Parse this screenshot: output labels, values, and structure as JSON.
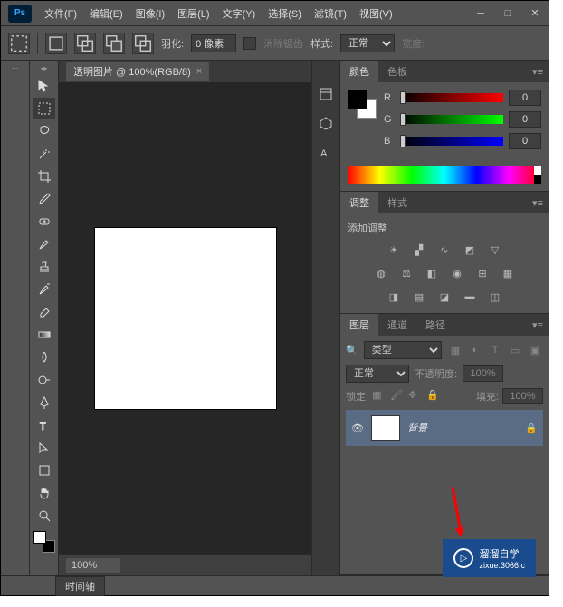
{
  "menu": [
    "文件(F)",
    "编辑(E)",
    "图像(I)",
    "图层(L)",
    "文字(Y)",
    "选择(S)",
    "滤镜(T)",
    "视图(V)"
  ],
  "options": {
    "feather_label": "羽化:",
    "feather_value": "0 像素",
    "antialias": "消除锯齿",
    "style_label": "样式:",
    "style_value": "正常",
    "width_label": "宽度:"
  },
  "document": {
    "tab_title": "透明图片 @ 100%(RGB/8)",
    "zoom": "100%"
  },
  "color_panel": {
    "tabs": [
      "颜色",
      "色板"
    ],
    "r": "0",
    "g": "0",
    "b": "0",
    "r_label": "R",
    "g_label": "G",
    "b_label": "B"
  },
  "adjustments_panel": {
    "tabs": [
      "调整",
      "样式"
    ],
    "title": "添加调整"
  },
  "layers_panel": {
    "tabs": [
      "图层",
      "通道",
      "路径"
    ],
    "filter_mode": "类型",
    "blend_mode": "正常",
    "opacity_label": "不透明度:",
    "opacity_value": "100%",
    "lock_label": "锁定:",
    "fill_label": "填充:",
    "fill_value": "100%",
    "layer_name": "背景"
  },
  "bottom": {
    "timeline": "时间轴"
  },
  "watermark": {
    "text": "溜溜自学",
    "url": "zixue.3066.c"
  }
}
